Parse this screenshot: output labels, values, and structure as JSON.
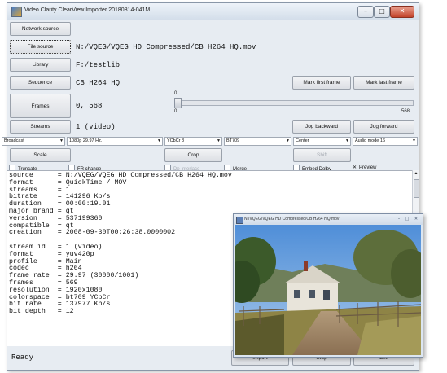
{
  "window": {
    "title": "Video Clarity ClearView Importer 20180814-041M",
    "controls": [
      "–",
      "□",
      "✕"
    ]
  },
  "rows": {
    "network_source": {
      "label": "Network source"
    },
    "file_source": {
      "label": "File source",
      "value": "N:/VQEG/VQEG HD Compressed/CB H264 HQ.mov"
    },
    "library": {
      "label": "Library",
      "value": "F:/testlib"
    },
    "sequence": {
      "label": "Sequence",
      "value": "CB H264 HQ",
      "mark_first": "Mark first frame",
      "mark_last": "Mark last frame"
    },
    "frames": {
      "label": "Frames",
      "value": "0, 568",
      "slider_start": "0",
      "slider_value": "0",
      "slider_end": "568",
      "slider_position": 0
    },
    "streams": {
      "label": "Streams",
      "value": "1 (video)",
      "jog_backward": "Jog backward",
      "jog_forward": "Jog forward"
    }
  },
  "dropdowns": [
    {
      "value": "Broadcast"
    },
    {
      "value": "1080p 29.97 Hz."
    },
    {
      "value": "YCbCr 8"
    },
    {
      "value": "BT709"
    },
    {
      "value": "Center"
    },
    {
      "value": "Audio mode 16"
    }
  ],
  "buttons": {
    "scale": "Scale",
    "crop": "Crop",
    "shift": "Shift"
  },
  "checkboxes": {
    "truncate": {
      "label": "Truncate",
      "checked": false
    },
    "fr_change": {
      "label": "FR change",
      "checked": false
    },
    "de_interlace": {
      "label": "De-interlace",
      "checked": false
    },
    "merge": {
      "label": "Merge",
      "checked": false
    },
    "embed_dolby": {
      "label": "Embed Dolby",
      "checked": false
    },
    "preview": {
      "label": "Preview",
      "checked": true,
      "mark": "✕"
    }
  },
  "info_text": "source      = N:/VQEG/VQEG HD Compressed/CB H264 HQ.mov\nformat      = QuickTime / MOV\nstreams     = 1\nbitrate     = 141296 Kb/s\nduration    = 00:00:19.01\nmajor brand = qt\nversion     = 537199360\ncompatible  = qt\ncreation    = 2008-09-30T00:26:38.0000002\n\nstream id   = 1 (video)\nformat      = yuv420p\nprofile     = Main\ncodec       = h264\nframe rate  = 29.97 (30000/1001)\nframes      = 569\nresolution  = 1920x1080\ncolorspace  = bt709 YCbCr\nbit rate    = 137977 Kb/s\nbit depth   = 12",
  "status": "Ready",
  "actions": {
    "import": "Import",
    "stop": "Stop",
    "exit": "Exit"
  },
  "preview_window": {
    "title": "N:/VQEG/VQEG HD Compressed/CB H264 HQ.mov",
    "controls": [
      "–",
      "□",
      "✕"
    ]
  },
  "scroll_arrows": {
    "up": "▲",
    "down": "▼"
  },
  "combo_arrow": "▼"
}
